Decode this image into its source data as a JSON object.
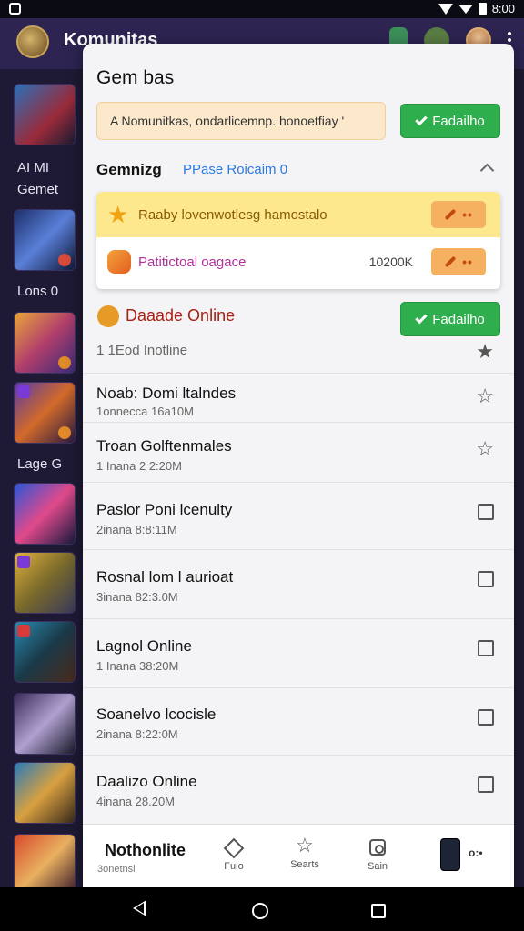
{
  "status_bar": {
    "time": "8:00"
  },
  "app_bar": {
    "title": "Komunitas"
  },
  "left_column": {
    "texts": [
      "AI MI",
      "Gemet",
      "Lons 0",
      "Lage G"
    ]
  },
  "panel": {
    "title": "Gem bas",
    "notice": "A Nomunitkas, ondarlicemnp. honoetfiay '",
    "primary_button": "Fadailho",
    "section": {
      "title": "Gemnizg",
      "subtitle": "PPase Roicaim 0"
    },
    "featured": [
      {
        "label": "Raaby lovenwotlesg hamostalo",
        "value": "",
        "icon": "star-icon"
      },
      {
        "label": "Patitictoal oagace",
        "value": "10200K",
        "icon": "hand-icon"
      }
    ],
    "online": {
      "title": "Daaade Online",
      "button": "Fadailho",
      "subtitle": "1 1Eod Inotline"
    },
    "items": [
      {
        "name": "Noab: Domi ltalndes",
        "meta": "1onnecca 16a10M",
        "control": "star"
      },
      {
        "name": "Troan Golftenmales",
        "meta": "1 Inana 2 2:20M",
        "control": "star"
      },
      {
        "name": "Paslor Poni lcenulty",
        "meta": "2inana 8:8:11M",
        "control": "checkbox"
      },
      {
        "name": "Rosnal lom l aurioat",
        "meta": "3inana 82:3.0M",
        "control": "checkbox"
      },
      {
        "name": "Lagnol Online",
        "meta": "1 Inana 38:20M",
        "control": "checkbox"
      },
      {
        "name": "Soanelvo lcocisle",
        "meta": "2inana 8:22:0M",
        "control": "checkbox"
      },
      {
        "name": "Daalizo Online",
        "meta": "4inana 28.20M",
        "control": "checkbox"
      }
    ],
    "bottom_nav": {
      "main_label": "Nothonlite",
      "main_sub": "3onetnsl",
      "items": [
        "Fuio",
        "Searts",
        "Sain"
      ],
      "extra": "o:•"
    }
  },
  "colors": {
    "accent_green": "#2fae4e",
    "app_bar": "#2d2452",
    "highlight_yellow": "#fde88e"
  }
}
